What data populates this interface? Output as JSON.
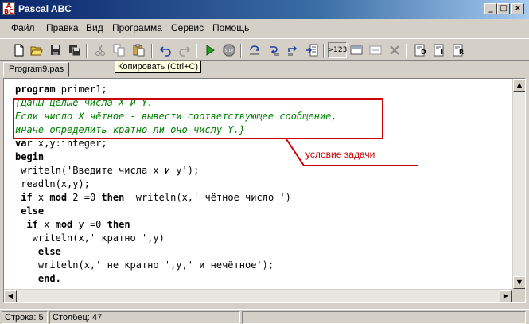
{
  "window": {
    "title": "Pascal ABC"
  },
  "menu": [
    "Файл",
    "Правка",
    "Вид",
    "Программа",
    "Сервис",
    "Помощь"
  ],
  "toolbar": {
    "icons": [
      "new-file-icon",
      "open-folder-icon",
      "save-icon",
      "save-all-icon",
      "cut-icon",
      "copy-icon",
      "paste-icon",
      "undo-icon",
      "redo-icon",
      "run-icon",
      "stop-icon",
      "step-over-icon",
      "step-into-icon",
      "step-out-icon",
      "run-to-cursor-icon",
      "watch-icon",
      "add-watch-icon",
      "delete-watch-icon",
      "format-d-icon",
      "format-i-icon",
      "format-r-icon"
    ],
    "watch_button_label": ">123",
    "tooltip": "Копировать (Ctrl+C)"
  },
  "tabs": [
    {
      "label": "Program9.pas"
    }
  ],
  "code": [
    [
      {
        "t": "program",
        "k": "kw"
      },
      {
        "t": " primer1;"
      }
    ],
    [
      {
        "t": "{Даны целые числа X и Y.",
        "k": "cm"
      }
    ],
    [
      {
        "t": "Если число X чётное - вывести соответствующее сообщение,",
        "k": "cm"
      }
    ],
    [
      {
        "t": "иначе определить кратно ли оно числу Y.}",
        "k": "cm"
      }
    ],
    [
      {
        "t": "var",
        "k": "kw"
      },
      {
        "t": " x,y:integer;"
      }
    ],
    [
      {
        "t": "begin",
        "k": "kw"
      }
    ],
    [
      {
        "t": " writeln('Введите числа x и y');"
      }
    ],
    [
      {
        "t": " readln(x,y);"
      }
    ],
    [
      {
        "t": " "
      },
      {
        "t": "if",
        "k": "kw"
      },
      {
        "t": " x "
      },
      {
        "t": "mod",
        "k": "kw"
      },
      {
        "t": " 2 =0 "
      },
      {
        "t": "then",
        "k": "kw"
      },
      {
        "t": "  writeln(x,' чётное число ')"
      }
    ],
    [
      {
        "t": " "
      },
      {
        "t": "else",
        "k": "kw"
      }
    ],
    [
      {
        "t": "  "
      },
      {
        "t": "if",
        "k": "kw"
      },
      {
        "t": " x "
      },
      {
        "t": "mod",
        "k": "kw"
      },
      {
        "t": " y =0 "
      },
      {
        "t": "then",
        "k": "kw"
      }
    ],
    [
      {
        "t": "   writeln(x,' кратно ',y)"
      }
    ],
    [
      {
        "t": "    "
      },
      {
        "t": "else",
        "k": "kw"
      }
    ],
    [
      {
        "t": "    writeln(x,' не кратно ',y,' и нечётное');"
      }
    ],
    [
      {
        "t": "    "
      },
      {
        "t": "end.",
        "k": "kw"
      }
    ]
  ],
  "annotation": {
    "label": "условие задачи",
    "color": "#cc0000"
  },
  "status": {
    "row": "Строка: 5",
    "col": "Столбец: 47"
  }
}
